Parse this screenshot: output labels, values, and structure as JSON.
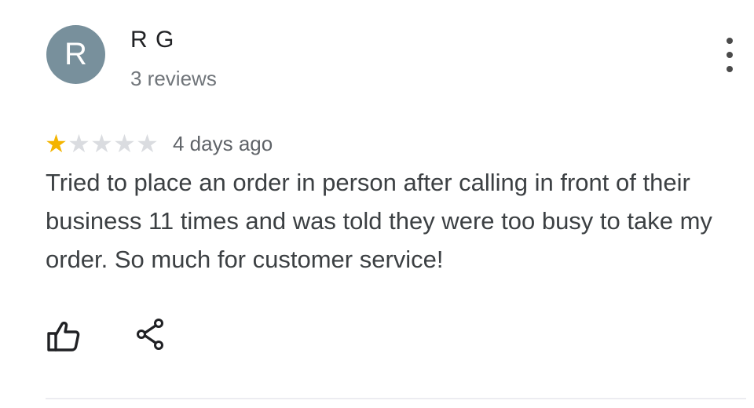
{
  "reviewer": {
    "initial": "R",
    "name": "R G",
    "review_count": "3 reviews",
    "avatar_color": "#78909c"
  },
  "review": {
    "rating": 1,
    "max_rating": 5,
    "date": "4 days ago",
    "text": "Tried to place an order in person after calling in front of their business 11 times and was told they were too busy to take my order. So much for customer service!"
  },
  "actions": {
    "like_icon": "thumbs-up-icon",
    "share_icon": "share-icon",
    "more_icon": "more-vert-icon"
  },
  "colors": {
    "star_filled": "#f4b400",
    "star_empty": "#dadce0",
    "secondary_text": "#70757a"
  }
}
